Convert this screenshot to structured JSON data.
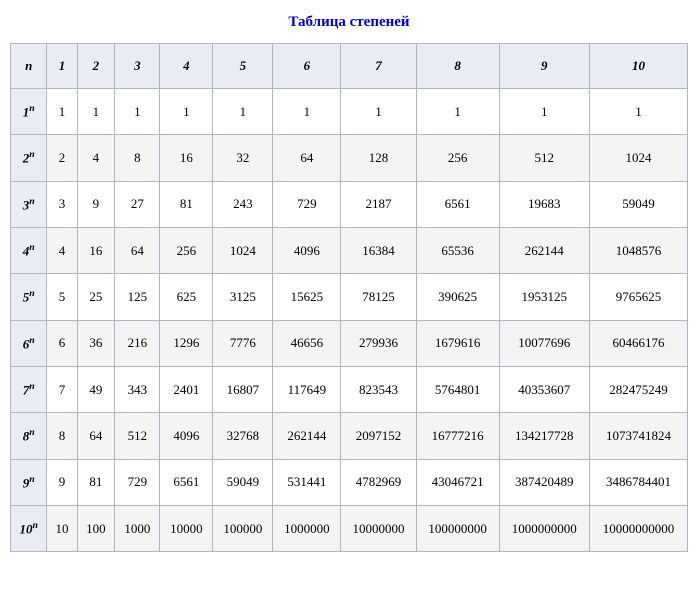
{
  "title": "Таблица степеней",
  "exponent_symbol": "n",
  "columns": [
    "1",
    "2",
    "3",
    "4",
    "5",
    "6",
    "7",
    "8",
    "9",
    "10"
  ],
  "rows": [
    {
      "base": "1",
      "values": [
        "1",
        "1",
        "1",
        "1",
        "1",
        "1",
        "1",
        "1",
        "1",
        "1"
      ]
    },
    {
      "base": "2",
      "values": [
        "2",
        "4",
        "8",
        "16",
        "32",
        "64",
        "128",
        "256",
        "512",
        "1024"
      ]
    },
    {
      "base": "3",
      "values": [
        "3",
        "9",
        "27",
        "81",
        "243",
        "729",
        "2187",
        "6561",
        "19683",
        "59049"
      ]
    },
    {
      "base": "4",
      "values": [
        "4",
        "16",
        "64",
        "256",
        "1024",
        "4096",
        "16384",
        "65536",
        "262144",
        "1048576"
      ]
    },
    {
      "base": "5",
      "values": [
        "5",
        "25",
        "125",
        "625",
        "3125",
        "15625",
        "78125",
        "390625",
        "1953125",
        "9765625"
      ]
    },
    {
      "base": "6",
      "values": [
        "6",
        "36",
        "216",
        "1296",
        "7776",
        "46656",
        "279936",
        "1679616",
        "10077696",
        "60466176"
      ]
    },
    {
      "base": "7",
      "values": [
        "7",
        "49",
        "343",
        "2401",
        "16807",
        "117649",
        "823543",
        "5764801",
        "40353607",
        "282475249"
      ]
    },
    {
      "base": "8",
      "values": [
        "8",
        "64",
        "512",
        "4096",
        "32768",
        "262144",
        "2097152",
        "16777216",
        "134217728",
        "1073741824"
      ]
    },
    {
      "base": "9",
      "values": [
        "9",
        "81",
        "729",
        "6561",
        "59049",
        "531441",
        "4782969",
        "43046721",
        "387420489",
        "3486784401"
      ]
    },
    {
      "base": "10",
      "values": [
        "10",
        "100",
        "1000",
        "10000",
        "100000",
        "1000000",
        "10000000",
        "100000000",
        "1000000000",
        "10000000000"
      ]
    }
  ]
}
